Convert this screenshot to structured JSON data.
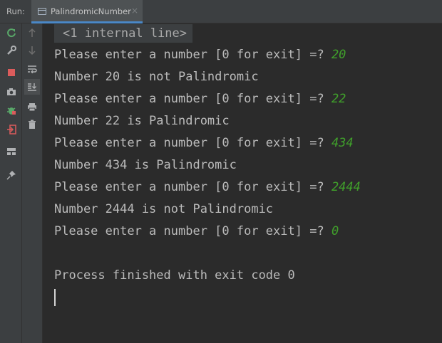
{
  "tab_bar": {
    "run_label": "Run:",
    "tab_label": "PalindromicNumber",
    "close_glyph": "×"
  },
  "toolbar_left": {
    "icons": [
      "rerun-icon",
      "wrench-icon",
      "stop-icon",
      "camera-icon",
      "debug-icon",
      "exit-icon",
      "layout-icon",
      "pin-icon"
    ]
  },
  "toolbar_right": {
    "icons": [
      "up-arrow-icon",
      "down-arrow-icon",
      "soft-wrap-icon",
      "scroll-to-end-icon",
      "print-icon",
      "trash-icon"
    ]
  },
  "console": {
    "internal_line": "<1 internal line>",
    "lines": [
      {
        "text": "Please enter a number [0 for exit] =? ",
        "input": "20"
      },
      {
        "text": "Number 20 is not Palindromic",
        "input": ""
      },
      {
        "text": "Please enter a number [0 for exit] =? ",
        "input": "22"
      },
      {
        "text": "Number 22 is Palindromic",
        "input": ""
      },
      {
        "text": "Please enter a number [0 for exit] =? ",
        "input": "434"
      },
      {
        "text": "Number 434 is Palindromic",
        "input": ""
      },
      {
        "text": "Please enter a number [0 for exit] =? ",
        "input": "2444"
      },
      {
        "text": "Number 2444 is not Palindromic",
        "input": ""
      },
      {
        "text": "Please enter a number [0 for exit] =? ",
        "input": "0"
      },
      {
        "text": "",
        "input": ""
      },
      {
        "text": "Process finished with exit code 0",
        "input": ""
      }
    ]
  },
  "colors": {
    "background": "#2b2b2b",
    "panel": "#3c3f41",
    "text": "#bbbbbb",
    "user_input": "#40a02b",
    "tab_underline": "#4a88c7"
  }
}
